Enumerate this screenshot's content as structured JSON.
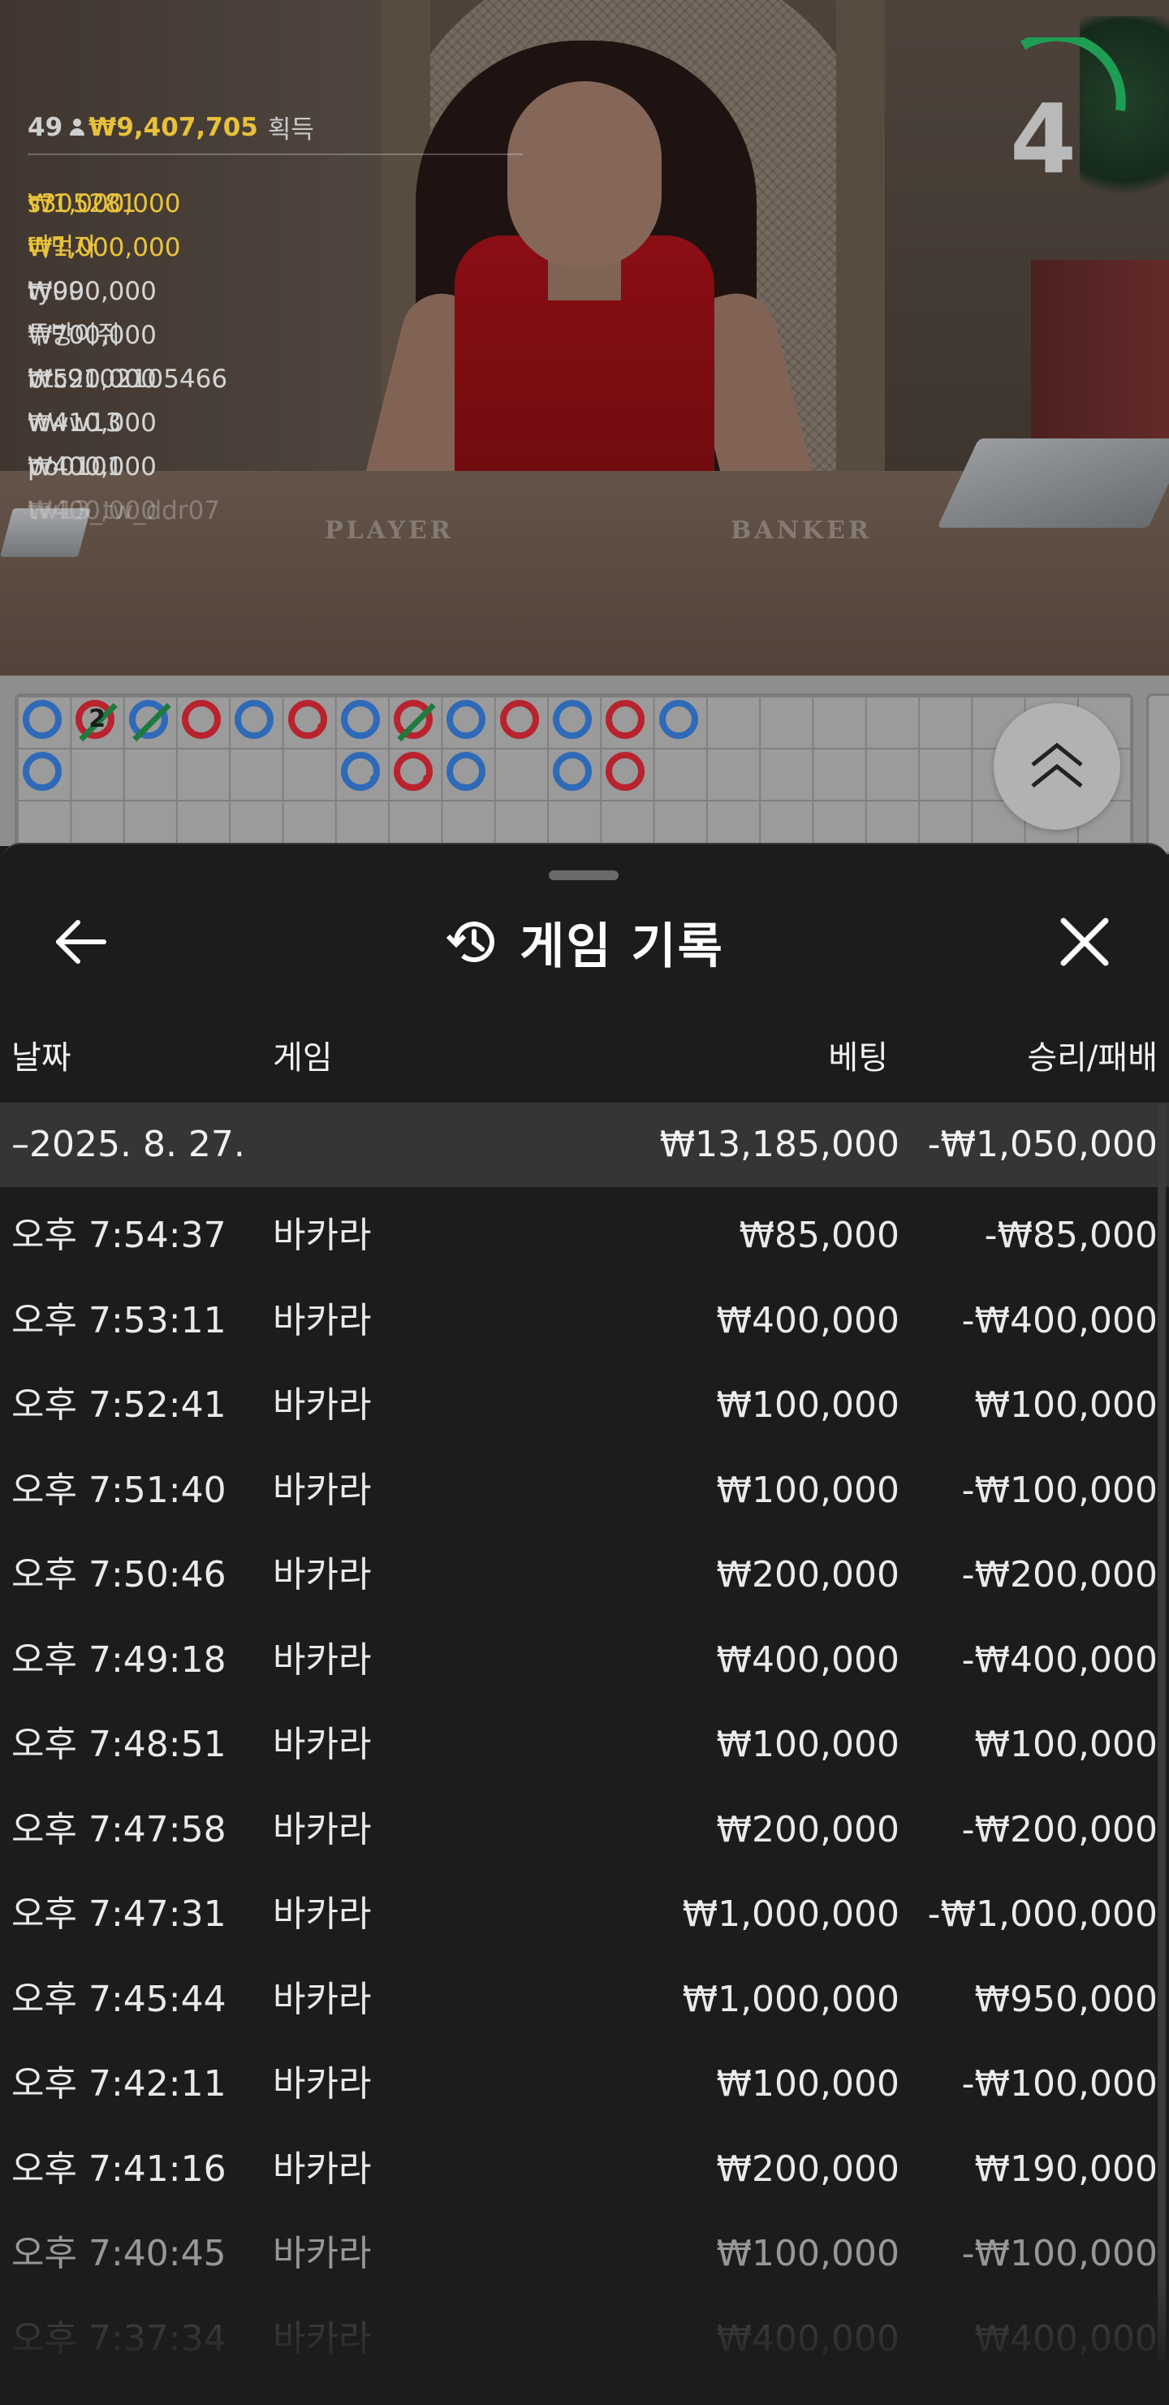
{
  "live": {
    "countdown": "4",
    "winners_header": {
      "count": "49",
      "total": "₩9,407,705",
      "suffix": "획득"
    },
    "winners": [
      {
        "amount": "₩1,000,000",
        "name": "s305281",
        "style": "gold"
      },
      {
        "amount": "₩1,000,000",
        "name": "따먹자",
        "style": "gold"
      },
      {
        "amount": "₩900,000",
        "name": "ty09",
        "style": "grey"
      },
      {
        "amount": "₩700,000",
        "name": "두방이쥐",
        "style": "grey"
      },
      {
        "amount": "₩520,000",
        "name": "btc9102105466",
        "style": "grey"
      },
      {
        "amount": "₩410,000",
        "name": "www13",
        "style": "grey"
      },
      {
        "amount": "₩400,000",
        "name": "po0101",
        "style": "grey"
      },
      {
        "amount": "₩400,000",
        "name": "tw13_tw_ddr07",
        "style": "fade"
      }
    ],
    "table_text": {
      "player": "PLAYER",
      "banker": "BANKER"
    }
  },
  "roadmap": {
    "marker_number": "2"
  },
  "history": {
    "title": "게임 기록",
    "columns": {
      "date": "날짜",
      "game": "게임",
      "bet": "베팅",
      "result": "승리/패배"
    },
    "summary": {
      "date": "–2025. 8. 27.",
      "bet": "₩13,185,000",
      "result": "-₩1,050,000"
    },
    "rows": [
      {
        "time": "오후 7:54:37",
        "game": "바카라",
        "bet": "₩85,000",
        "result": "-₩85,000"
      },
      {
        "time": "오후 7:53:11",
        "game": "바카라",
        "bet": "₩400,000",
        "result": "-₩400,000"
      },
      {
        "time": "오후 7:52:41",
        "game": "바카라",
        "bet": "₩100,000",
        "result": "₩100,000"
      },
      {
        "time": "오후 7:51:40",
        "game": "바카라",
        "bet": "₩100,000",
        "result": "-₩100,000"
      },
      {
        "time": "오후 7:50:46",
        "game": "바카라",
        "bet": "₩200,000",
        "result": "-₩200,000"
      },
      {
        "time": "오후 7:49:18",
        "game": "바카라",
        "bet": "₩400,000",
        "result": "-₩400,000"
      },
      {
        "time": "오후 7:48:51",
        "game": "바카라",
        "bet": "₩100,000",
        "result": "₩100,000"
      },
      {
        "time": "오후 7:47:58",
        "game": "바카라",
        "bet": "₩200,000",
        "result": "-₩200,000"
      },
      {
        "time": "오후 7:47:31",
        "game": "바카라",
        "bet": "₩1,000,000",
        "result": "-₩1,000,000"
      },
      {
        "time": "오후 7:45:44",
        "game": "바카라",
        "bet": "₩1,000,000",
        "result": "₩950,000"
      },
      {
        "time": "오후 7:42:11",
        "game": "바카라",
        "bet": "₩100,000",
        "result": "-₩100,000"
      },
      {
        "time": "오후 7:41:16",
        "game": "바카라",
        "bet": "₩200,000",
        "result": "₩190,000"
      },
      {
        "time": "오후 7:40:45",
        "game": "바카라",
        "bet": "₩100,000",
        "result": "-₩100,000"
      },
      {
        "time": "오후 7:37:34",
        "game": "바카라",
        "bet": "₩400,000",
        "result": "₩400,000"
      }
    ]
  },
  "colors": {
    "player": "#2f6ab8",
    "banker": "#b8232d",
    "tie": "#1e7a3e",
    "winner_gold": "#e9c43b",
    "timer_green": "#1f9d55"
  },
  "icons": {
    "back": "arrow-left-icon",
    "history": "history-icon",
    "close": "close-icon",
    "expand": "chevron-double-up-icon",
    "person": "person-icon"
  }
}
